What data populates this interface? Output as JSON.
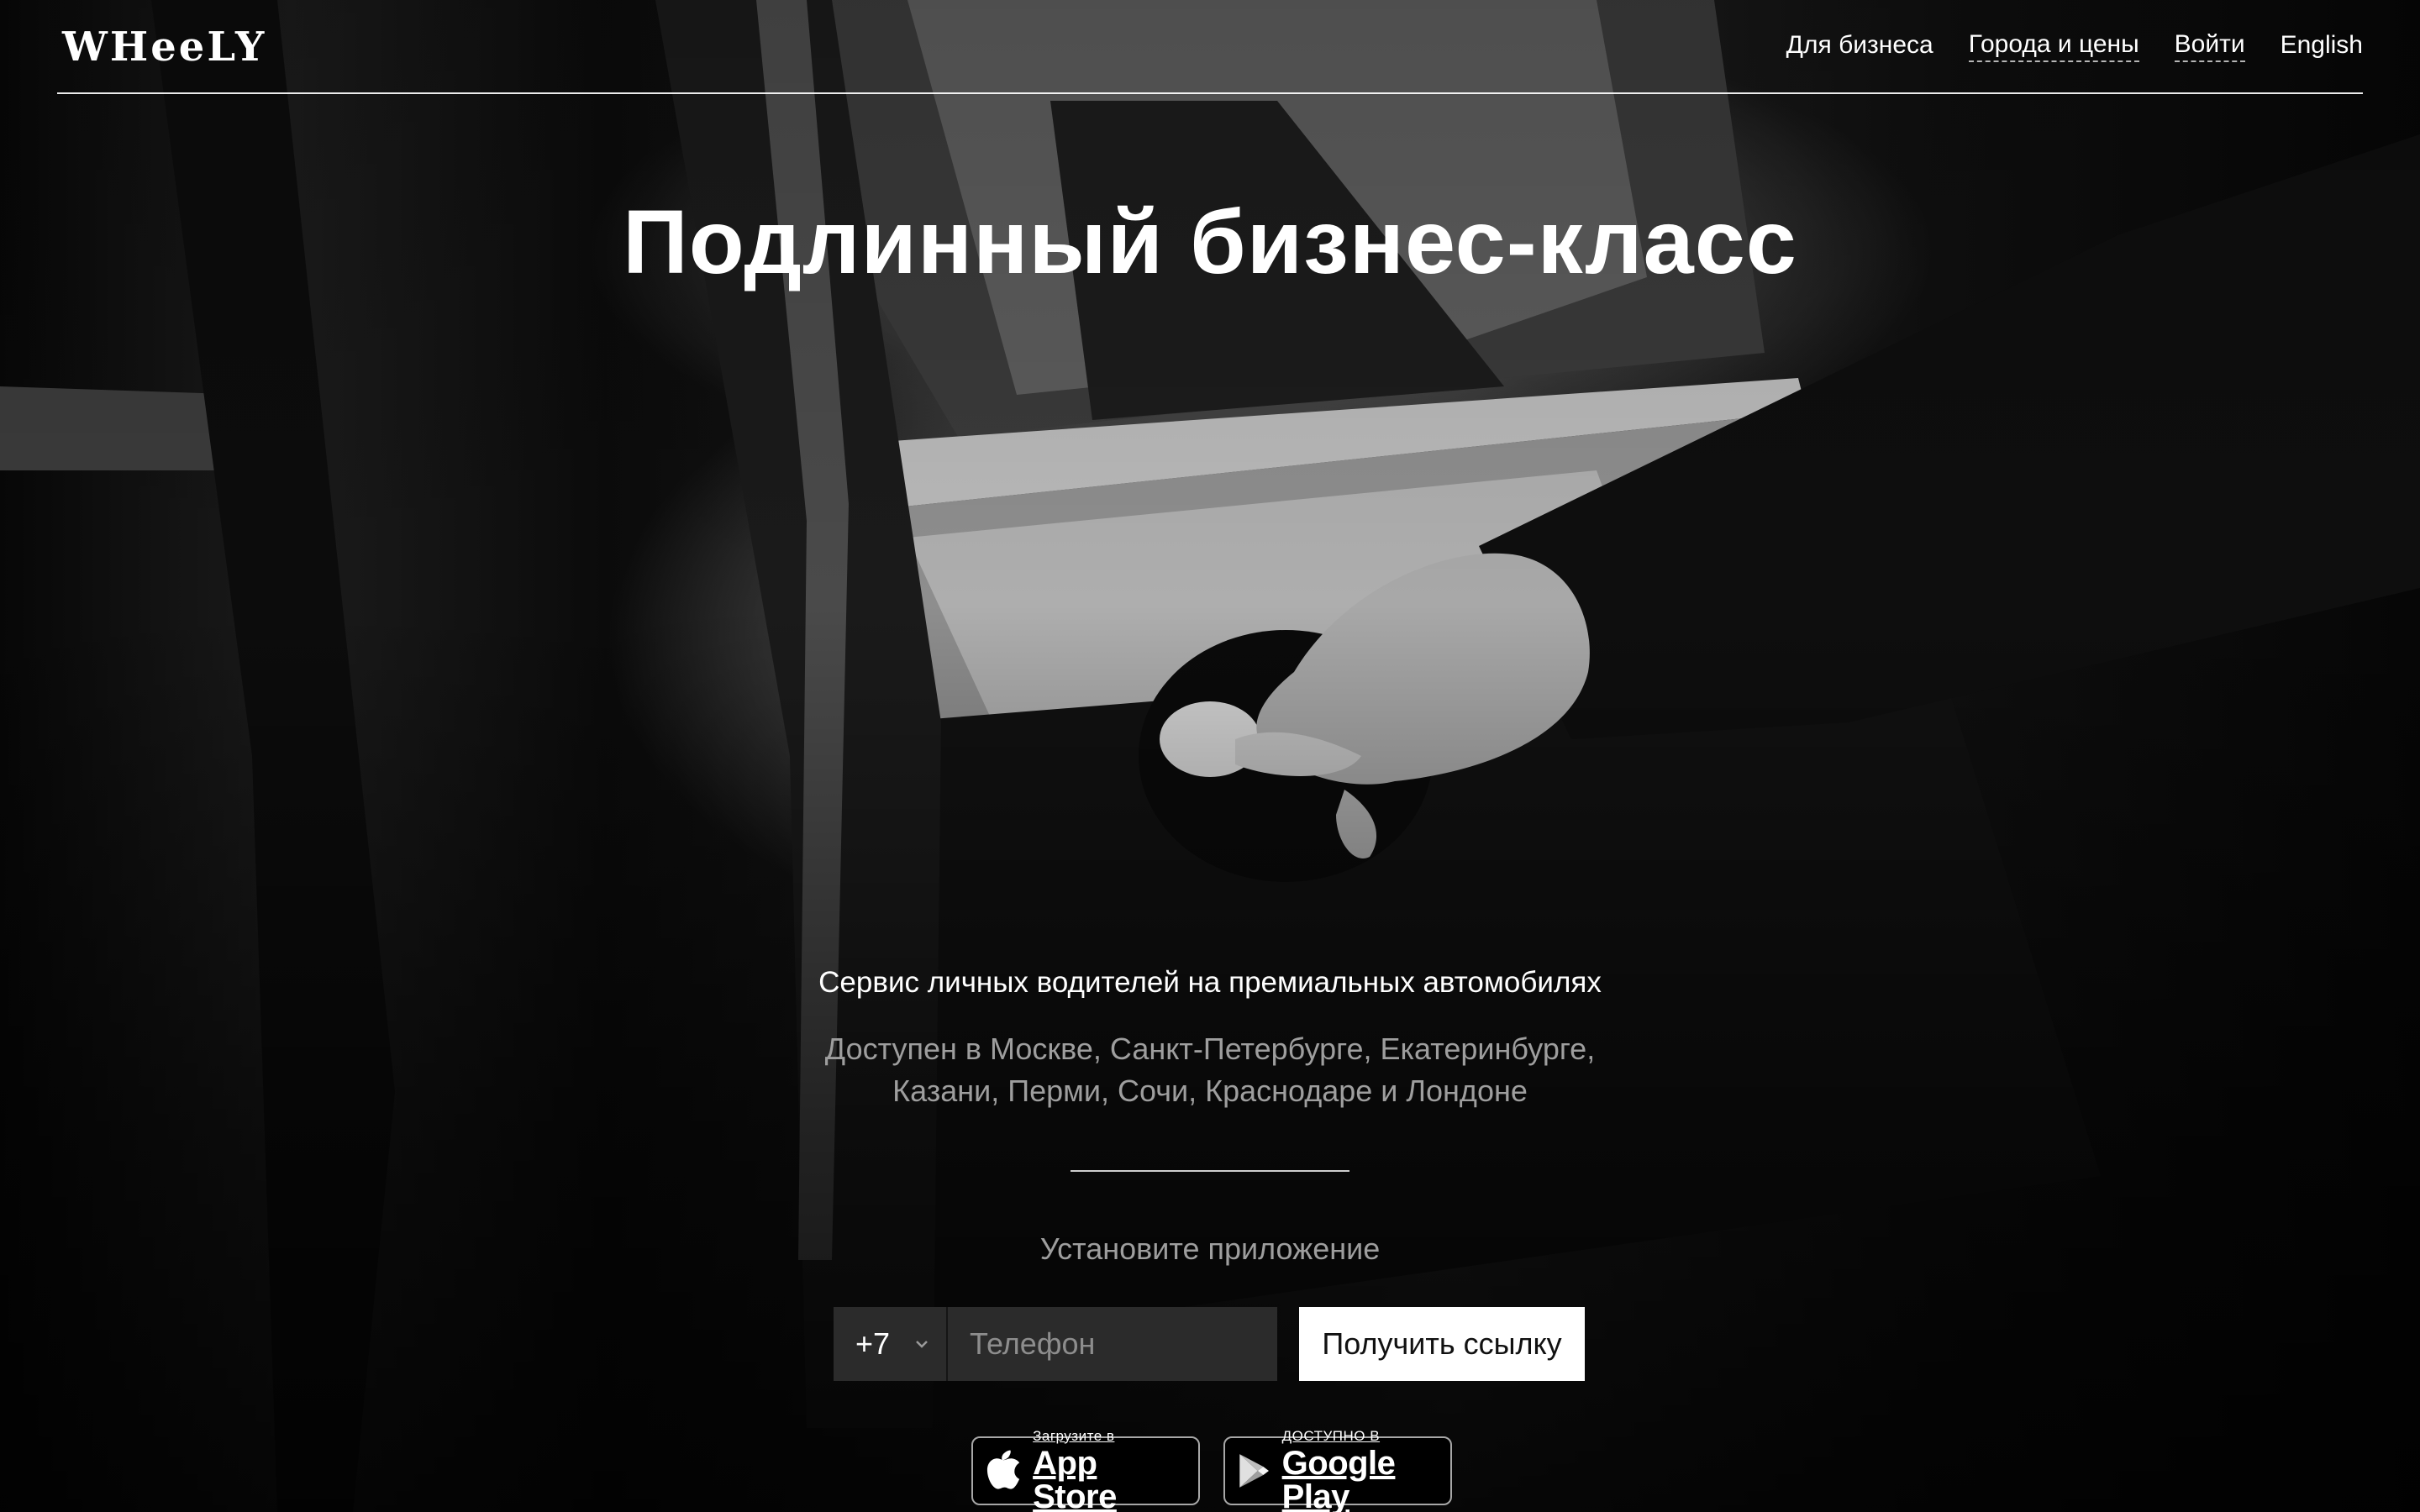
{
  "header": {
    "logo": "WHeeLY",
    "nav": {
      "business": "Для бизнеса",
      "cities": "Города и цены",
      "login": "Войти",
      "language": "English"
    }
  },
  "hero": {
    "title": "Подлинный бизнес-класс",
    "subtitle": "Сервис личных водителей на премиальных автомобилях",
    "cities_line1": "Доступен в Москве, Санкт-Петербурге, Екатеринбурге,",
    "cities_line2": "Казани, Перми, Сочи, Краснодаре и Лондоне"
  },
  "install": {
    "label": "Установите приложение",
    "country_code": "+7",
    "phone_placeholder": "Телефон",
    "phone_value": "",
    "button": "Получить ссылку"
  },
  "badges": {
    "app_store": {
      "small": "Загрузите в",
      "big": "App Store",
      "icon": "apple-icon"
    },
    "google_play": {
      "small": "ДОСТУПНО В",
      "big": "Google Play",
      "icon": "google-play-icon"
    }
  },
  "colors": {
    "background": "#050505",
    "text": "#ffffff",
    "muted_text": "#9e9e9e",
    "input_bg": "#2b2b2b",
    "button_bg": "#ffffff"
  }
}
